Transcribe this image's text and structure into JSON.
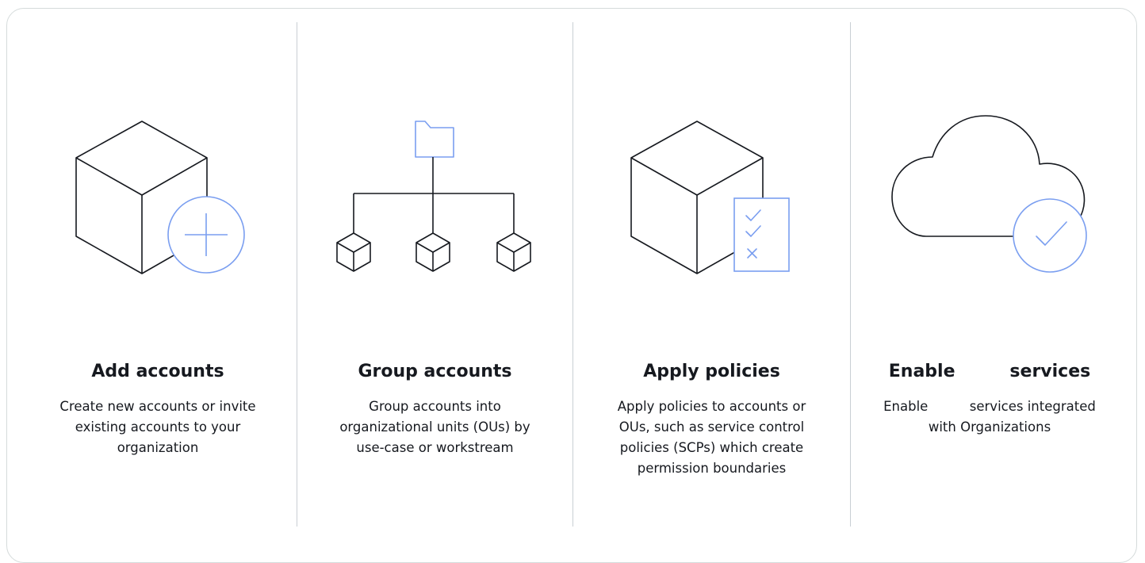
{
  "colors": {
    "outline": "#16191f",
    "accent": "#7a9ef0",
    "divider": "#c9cfd4",
    "card_border": "#d5dbdb"
  },
  "columns": [
    {
      "icon": "cube-plus-icon",
      "title": "Add accounts",
      "description": [
        "Create new accounts or invite",
        "existing accounts to your",
        "organization"
      ]
    },
    {
      "icon": "org-tree-icon",
      "title": "Group accounts",
      "description": [
        "Group accounts into",
        "organizational units (OUs) by",
        "use-case or workstream"
      ]
    },
    {
      "icon": "cube-checklist-icon",
      "title": "Apply policies",
      "description": [
        "Apply policies to accounts or",
        "OUs, such as service control",
        "policies (SCPs) which create",
        "permission boundaries"
      ]
    },
    {
      "icon": "cloud-check-icon",
      "title": "Enable         services",
      "description": [
        "Enable          services integrated",
        "with Organizations"
      ]
    }
  ]
}
